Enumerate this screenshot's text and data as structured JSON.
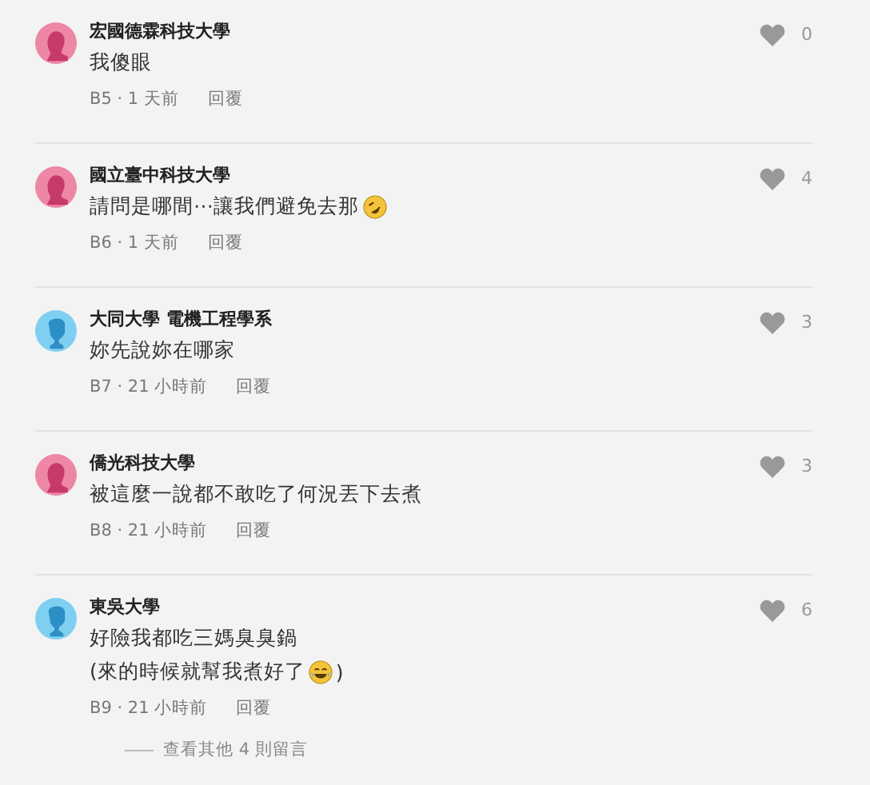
{
  "comments": [
    {
      "avatar": {
        "kind": "female"
      },
      "author": "宏國德霖科技大學",
      "lines": [
        [
          {
            "kind": "text",
            "text": "我傻眼"
          }
        ]
      ],
      "meta": "B5 · 1 天前",
      "reply": "回覆",
      "likes": "0"
    },
    {
      "avatar": {
        "kind": "female"
      },
      "author": "國立臺中科技大學",
      "lines": [
        [
          {
            "kind": "text",
            "text": "請問是哪間⋯讓我們避免去那"
          },
          {
            "kind": "rofl"
          }
        ]
      ],
      "meta": "B6 · 1 天前",
      "reply": "回覆",
      "likes": "4"
    },
    {
      "avatar": {
        "kind": "male"
      },
      "author": "大同大學 電機工程學系",
      "lines": [
        [
          {
            "kind": "text",
            "text": "妳先說妳在哪家"
          }
        ]
      ],
      "meta": "B7 · 21 小時前",
      "reply": "回覆",
      "likes": "3"
    },
    {
      "avatar": {
        "kind": "female"
      },
      "author": "僑光科技大學",
      "lines": [
        [
          {
            "kind": "text",
            "text": "被這麼一說都不敢吃了何況丟下去煮"
          }
        ]
      ],
      "meta": "B8 · 21 小時前",
      "reply": "回覆",
      "likes": "3"
    },
    {
      "avatar": {
        "kind": "male"
      },
      "author": "東吳大學",
      "lines": [
        [
          {
            "kind": "text",
            "text": "好險我都吃三媽臭臭鍋"
          }
        ],
        [
          {
            "kind": "text",
            "text": "(來的時候就幫我煮好了"
          },
          {
            "kind": "joy"
          },
          {
            "kind": "text",
            "text": " )"
          }
        ]
      ],
      "meta": "B9 · 21 小時前",
      "reply": "回覆",
      "likes": "6"
    }
  ],
  "more_link": "查看其他 4 則留言"
}
